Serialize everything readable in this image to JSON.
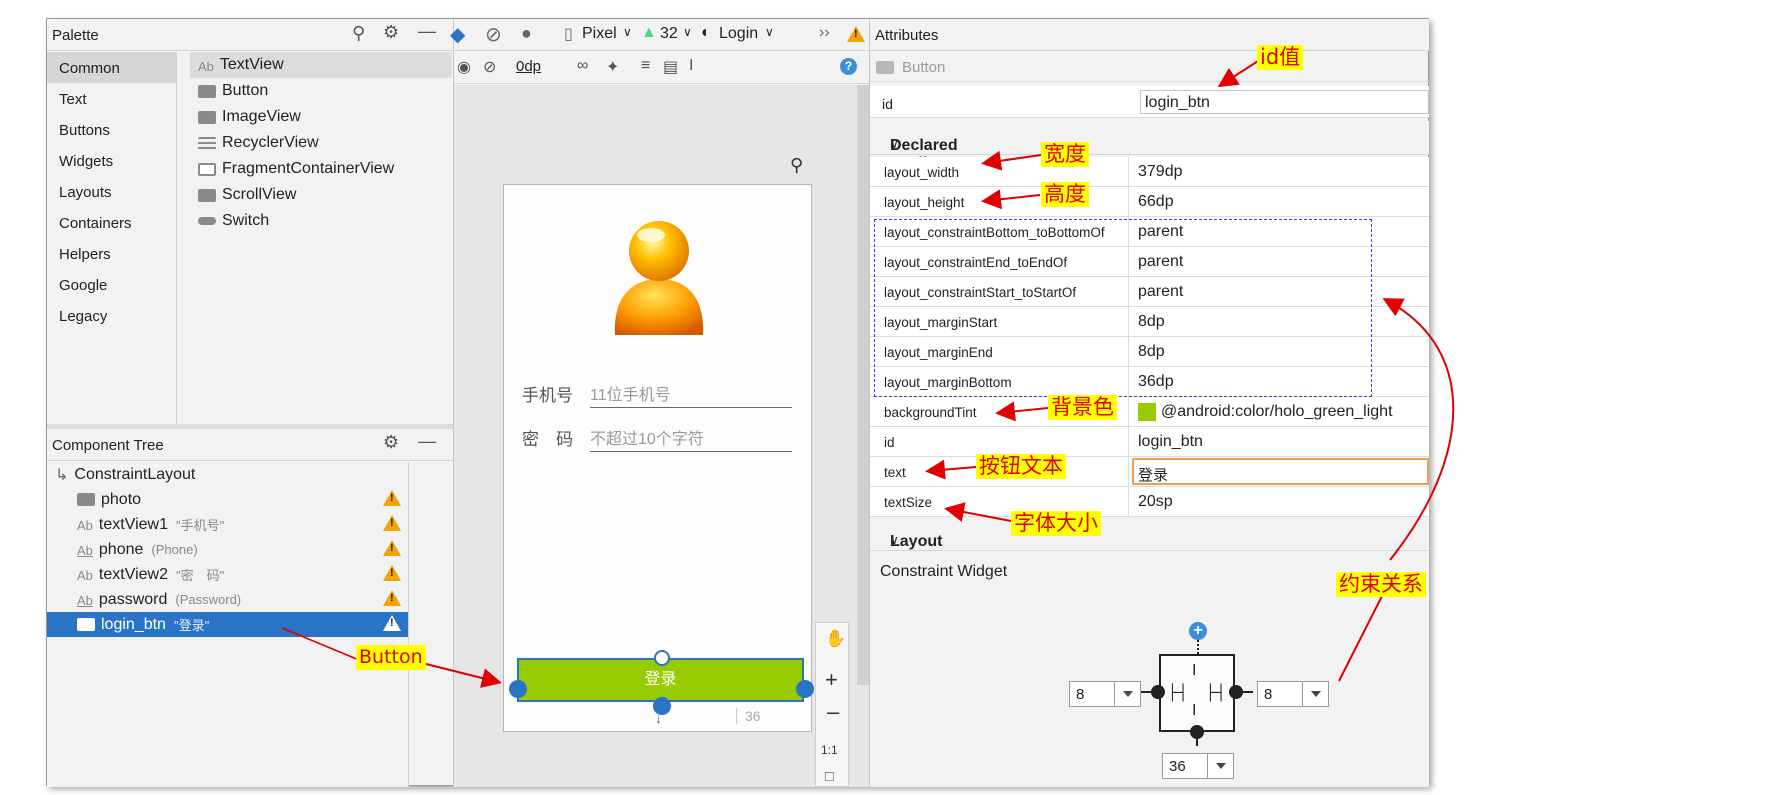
{
  "palette": {
    "title": "Palette",
    "categories": [
      "Common",
      "Text",
      "Buttons",
      "Widgets",
      "Layouts",
      "Containers",
      "Helpers",
      "Google",
      "Legacy"
    ],
    "items": [
      {
        "label": "TextView",
        "icon": "textview-icon",
        "glyph": "Ab"
      },
      {
        "label": "Button",
        "icon": "button-icon"
      },
      {
        "label": "ImageView",
        "icon": "imageview-icon"
      },
      {
        "label": "RecyclerView",
        "icon": "list-icon"
      },
      {
        "label": "FragmentContainerView",
        "icon": "fragment-icon"
      },
      {
        "label": "ScrollView",
        "icon": "scrollview-icon"
      },
      {
        "label": "Switch",
        "icon": "switch-icon"
      }
    ]
  },
  "tree": {
    "title": "Component Tree",
    "root": "ConstraintLayout",
    "nodes": [
      {
        "name": "photo",
        "hint": ""
      },
      {
        "name": "textView1",
        "hint": "\"手机号\""
      },
      {
        "name": "phone",
        "hint": "(Phone)"
      },
      {
        "name": "textView2",
        "hint": "\"密　码\""
      },
      {
        "name": "password",
        "hint": "(Password)"
      },
      {
        "name": "login_btn",
        "hint": "\"登录\""
      }
    ]
  },
  "toolbar": {
    "device": "Pixel",
    "api": "32",
    "theme": "Login",
    "margin": "0dp",
    "more": "››"
  },
  "preview": {
    "phone_label": "手机号",
    "phone_hint": "11位手机号",
    "pwd_label": "密　码",
    "pwd_hint": "不超过10个字符",
    "button_text": "登录",
    "bottom_margin": "36",
    "zoom_ratio": "1:1"
  },
  "attributes": {
    "title": "Attributes",
    "widget": "Button",
    "id_key": "id",
    "id_value": "login_btn",
    "declared_title": "Declared Attributes",
    "declared": [
      {
        "k": "layout_width",
        "v": "379dp"
      },
      {
        "k": "layout_height",
        "v": "66dp"
      },
      {
        "k": "layout_constraintBottom_toBottomOf",
        "v": "parent"
      },
      {
        "k": "layout_constraintEnd_toEndOf",
        "v": "parent"
      },
      {
        "k": "layout_constraintStart_toStartOf",
        "v": "parent"
      },
      {
        "k": "layout_marginStart",
        "v": "8dp"
      },
      {
        "k": "layout_marginEnd",
        "v": "8dp"
      },
      {
        "k": "layout_marginBottom",
        "v": "36dp"
      },
      {
        "k": "backgroundTint",
        "v": "@android:color/holo_green_light"
      },
      {
        "k": "id",
        "v": "login_btn"
      },
      {
        "k": "text",
        "v": "登录"
      },
      {
        "k": "textSize",
        "v": "20sp"
      }
    ],
    "layout_title": "Layout",
    "constraint_widget": "Constraint Widget",
    "margin_left": "8",
    "margin_right": "8",
    "margin_bottom": "36"
  },
  "notes": {
    "id": "id值",
    "width": "宽度",
    "height": "高度",
    "bg": "背景色",
    "text": "按钮文本",
    "size": "字体大小",
    "button": "Button",
    "constraint": "约束关系"
  },
  "colors": {
    "accent_green": "#99cc00",
    "selection_blue": "#2a74c6",
    "annotation_red": "#e00000",
    "annotation_bg": "#ffff00",
    "warning": "#f0a30a"
  }
}
